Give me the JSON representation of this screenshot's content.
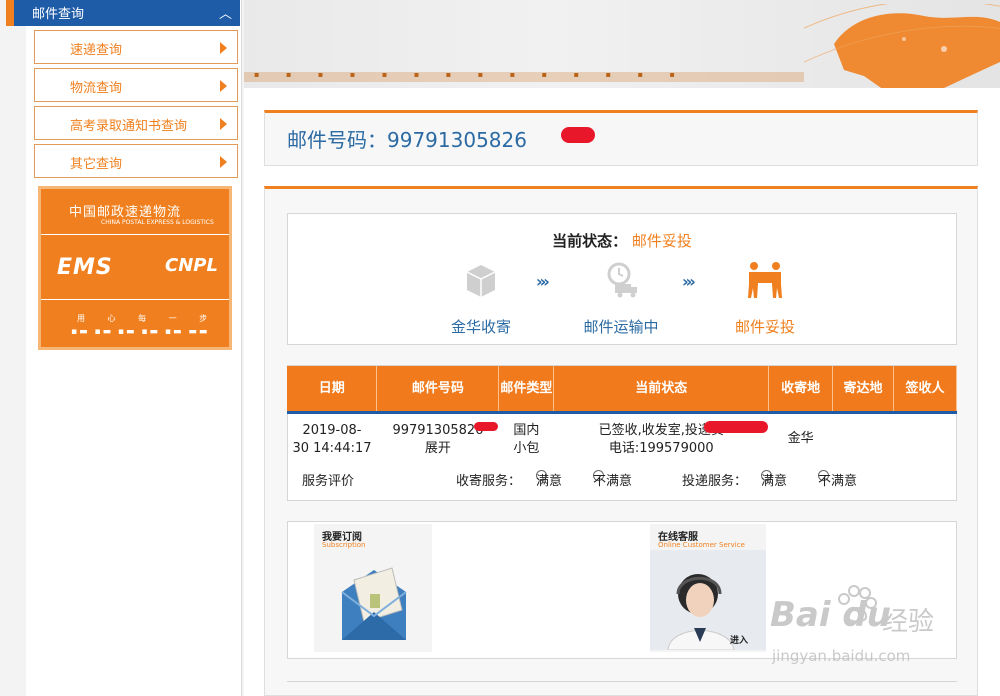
{
  "sidebar": {
    "header": "邮件查询",
    "items": [
      {
        "label": "速递查询"
      },
      {
        "label": "物流查询"
      },
      {
        "label": "高考录取通知书查询"
      },
      {
        "label": "其它查询"
      }
    ],
    "banner": {
      "cn": "中国邮政速递物流",
      "en": "CHINA POSTAL EXPRESS & LOGISTICS",
      "ems": "EMS",
      "cnpl": "CNPL",
      "slogan": "用 心 每 一 步"
    }
  },
  "mail": {
    "label": "邮件号码：",
    "number": "99791305826"
  },
  "status": {
    "title_key": "当前状态：",
    "title_value": "邮件妥投",
    "steps": [
      {
        "label": "金华收寄",
        "icon": "package-icon"
      },
      {
        "label": "邮件运输中",
        "icon": "truck-transit-icon"
      },
      {
        "label": "邮件妥投",
        "icon": "delivery-persons-icon"
      }
    ]
  },
  "table": {
    "headers": [
      "日期",
      "邮件号码",
      "邮件类型",
      "当前状态",
      "收寄地",
      "寄达地",
      "签收人"
    ],
    "row": {
      "date_line1": "2019-08-",
      "date_line2": "30 14:44:17",
      "mail_no": "99791305826",
      "expand": "展开",
      "type_line1": "国内",
      "type_line2": "小包",
      "status_line1": "已签收,收发室,投递员",
      "status_line2": "电话:199579000",
      "origin": "金华",
      "destination": "",
      "signer": ""
    }
  },
  "rating": {
    "label": "服务评价",
    "pickup_label": "收寄服务：",
    "delivery_label": "投递服务：",
    "satisfied": "满意",
    "unsatisfied": "不满意"
  },
  "promo": {
    "subscribe_title": "我要订阅",
    "subscribe_sub": "Subscription",
    "service_title": "在线客服",
    "service_sub": "Online Customer Service",
    "service_enter": "进入"
  },
  "watermark": {
    "brand": "Bai du",
    "cn": "经验",
    "url": "jingyan.baidu.com"
  },
  "colors": {
    "accent_orange": "#f0801f",
    "link_blue": "#2b6aa3",
    "nav_blue": "#1f5ca8"
  }
}
